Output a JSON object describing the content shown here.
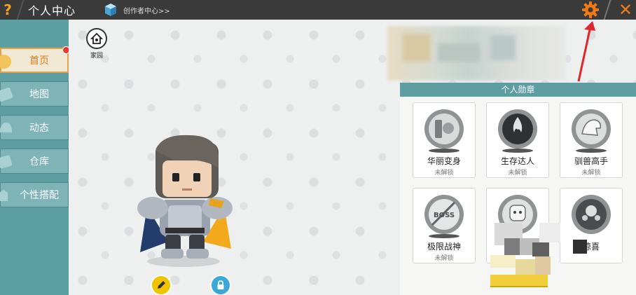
{
  "topbar": {
    "help_symbol": "?",
    "title": "个人中心",
    "creator_link": "创作者中心>>",
    "close_symbol": "✕"
  },
  "sidebar": {
    "items": [
      {
        "label": "首页",
        "active": true,
        "has_notification": true
      },
      {
        "label": "地图",
        "active": false
      },
      {
        "label": "动态",
        "active": false
      },
      {
        "label": "仓库",
        "active": false
      },
      {
        "label": "个性搭配",
        "active": false
      }
    ]
  },
  "main": {
    "home_label": "家园"
  },
  "badges": {
    "header": "个人勋章",
    "items": [
      {
        "name": "华丽变身",
        "status": "未解锁"
      },
      {
        "name": "生存达人",
        "status": "未解锁"
      },
      {
        "name": "驯兽高手",
        "status": "未解锁"
      },
      {
        "name": "极限战神",
        "status": "未解锁"
      },
      {
        "name": "",
        "status": ""
      },
      {
        "name": "惊喜",
        "status": ""
      }
    ]
  },
  "colors": {
    "sidebar_bg": "#5d9ea3",
    "active_tab_text": "#e07b1e",
    "topbar_bg": "#3a3a3a",
    "settings_orange": "#f07a18",
    "annotation_red": "#e0262a"
  }
}
